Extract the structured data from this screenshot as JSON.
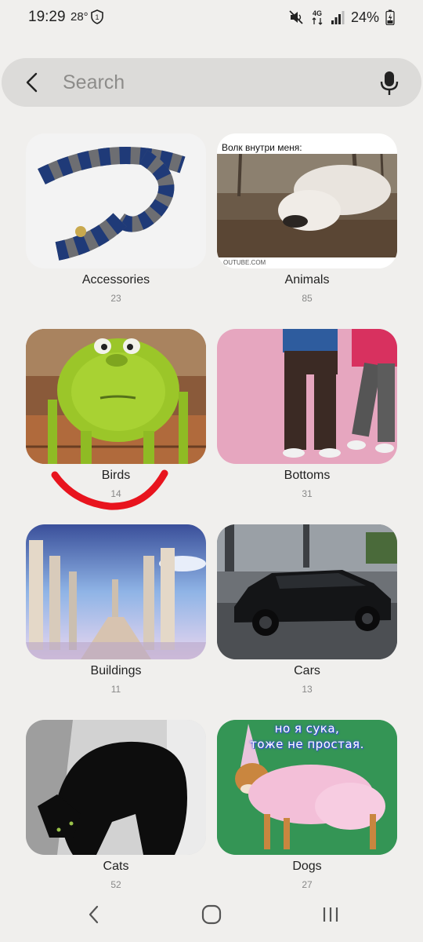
{
  "status_bar": {
    "time": "19:29",
    "temperature": "28°",
    "battery": "24%",
    "network": "4G",
    "icons": [
      "shield-icon",
      "mute-icon",
      "signal-icon",
      "battery-icon"
    ]
  },
  "search": {
    "placeholder": "Search",
    "icons": [
      "back-arrow-icon",
      "microphone-icon"
    ]
  },
  "categories": [
    {
      "label": "Accessories",
      "count": "23"
    },
    {
      "label": "Animals",
      "count": "85",
      "caption": "Волк внутри меня:",
      "footer": "OUTUBE.COM"
    },
    {
      "label": "Birds",
      "count": "14"
    },
    {
      "label": "Bottoms",
      "count": "31"
    },
    {
      "label": "Buildings",
      "count": "11"
    },
    {
      "label": "Cars",
      "count": "13"
    },
    {
      "label": "Cats",
      "count": "52"
    },
    {
      "label": "Dogs",
      "count": "27",
      "caption_line1": "но я сука,",
      "caption_line2": "тоже не простая."
    }
  ],
  "nav_bar": {
    "icons": [
      "nav-back-icon",
      "nav-home-icon",
      "nav-recents-icon"
    ]
  },
  "colors": {
    "background": "#f0efed",
    "search_bg": "#dcdbd9",
    "annotation": "#e8141e"
  }
}
